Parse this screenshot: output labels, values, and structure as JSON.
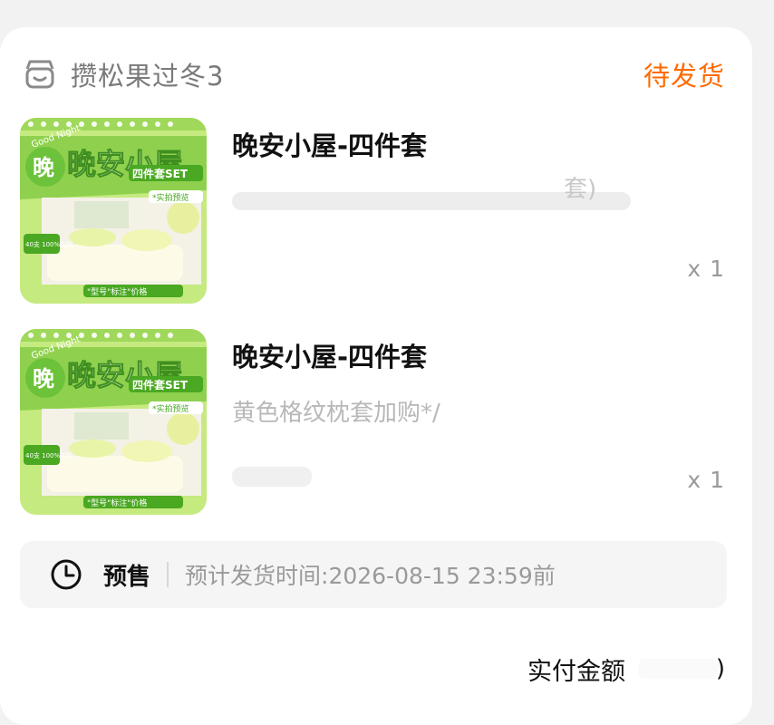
{
  "shop": {
    "name": "攒松果过冬3",
    "status": "待发货",
    "icon": "shop-icon"
  },
  "items": [
    {
      "title": "晚安小屋-四件套",
      "spec": "",
      "spec_tail": "套)",
      "quantity": "x 1",
      "thumbnail": {
        "brand_text": "晚安小屋",
        "set_text": "四件套SET",
        "tag1": "40支 100%纯棉",
        "tag2": "*实拍预览",
        "tag3": "\"型号\"标注\"价格",
        "greeting": "Good Night"
      }
    },
    {
      "title": "晚安小屋-四件套",
      "spec": "黄色格纹枕套加购*/",
      "quantity": "x 1",
      "thumbnail": {
        "brand_text": "晚安小屋",
        "set_text": "四件套SET",
        "tag1": "40支 100%纯棉",
        "tag2": "*实拍预览",
        "tag3": "\"型号\"标注\"价格",
        "greeting": "Good Night"
      }
    }
  ],
  "presale": {
    "icon": "clock-icon",
    "label": "预售",
    "text": "预计发货时间:2026-08-15 23:59前"
  },
  "payment": {
    "label": "实付金额",
    "amount_tail": ")"
  },
  "colors": {
    "status_orange": "#ff6a00",
    "thumbnail_green": "#8fd14f",
    "background": "#f2f2f2"
  }
}
